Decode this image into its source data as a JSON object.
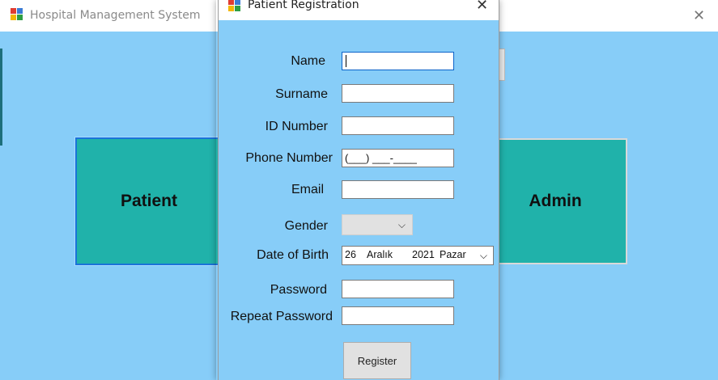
{
  "main_window": {
    "title": "Hospital Management System",
    "close_glyph": "✕",
    "buttons": {
      "patient": "Patient",
      "admin": "Admin"
    }
  },
  "dialog": {
    "title": "Patient Registration",
    "close_glyph": "✕",
    "labels": {
      "name": "Name",
      "surname": "Surname",
      "id_number": "ID Number",
      "phone": "Phone Number",
      "email": "Email",
      "gender": "Gender",
      "dob": "Date of Birth",
      "password": "Password",
      "repeat_password": "Repeat Password"
    },
    "fields": {
      "name": "",
      "surname": "",
      "id_number": "",
      "phone_mask": "(___) ___-____",
      "email": "",
      "gender": "",
      "dob": {
        "day": "26",
        "month": "Aralık",
        "year": "2021",
        "weekday": "Pazar"
      },
      "password": "",
      "repeat_password": ""
    },
    "register_label": "Register"
  },
  "icons": {
    "app": "app-window-icon",
    "dropdown": "chevron-down-icon",
    "close": "close-icon"
  },
  "colors": {
    "client_bg": "#87cdf8",
    "button_teal": "#20b2aa",
    "focus_blue": "#1a73d9"
  }
}
